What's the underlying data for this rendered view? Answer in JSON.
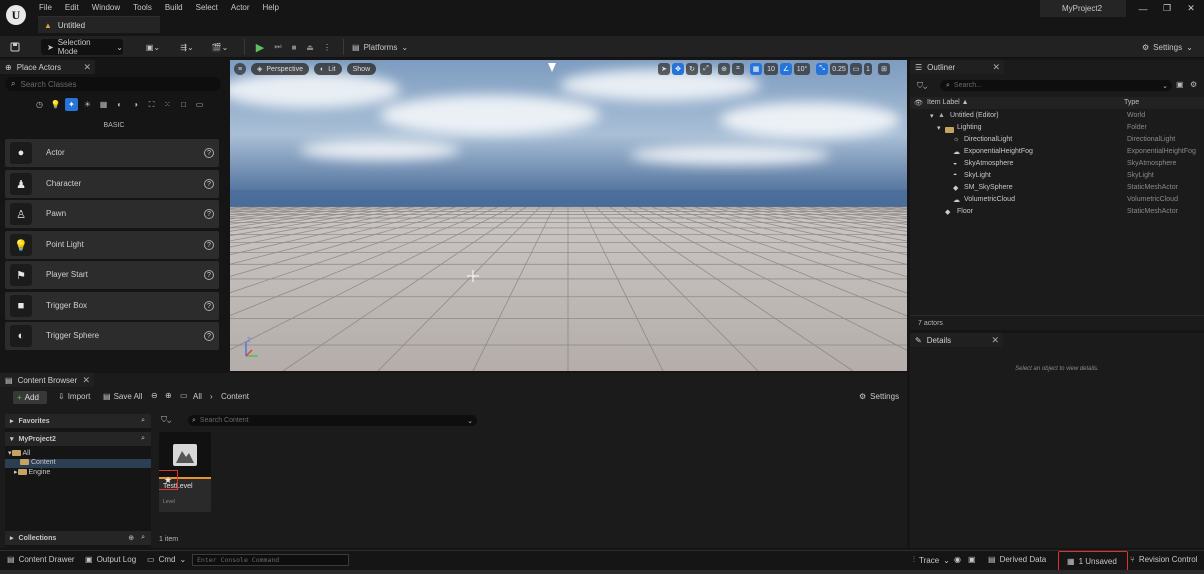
{
  "app": {
    "logo": "U",
    "menu": [
      "File",
      "Edit",
      "Window",
      "Tools",
      "Build",
      "Select",
      "Actor",
      "Help"
    ],
    "document_tab": "Untitled",
    "project": "MyProject2",
    "window_controls": {
      "minimize": "—",
      "maximize": "❐",
      "close": "✕"
    }
  },
  "toolbar": {
    "selection_mode": "Selection Mode",
    "platforms": "Platforms",
    "settings": "Settings"
  },
  "place_actors": {
    "tab": "Place Actors",
    "search_placeholder": "Search Classes",
    "category_label": "BASIC",
    "items": [
      {
        "label": "Actor",
        "icon": "●"
      },
      {
        "label": "Character",
        "icon": "♟"
      },
      {
        "label": "Pawn",
        "icon": "♙"
      },
      {
        "label": "Point Light",
        "icon": "💡"
      },
      {
        "label": "Player Start",
        "icon": "⚑"
      },
      {
        "label": "Trigger Box",
        "icon": "■"
      },
      {
        "label": "Trigger Sphere",
        "icon": "◐"
      }
    ]
  },
  "viewport": {
    "perspective": "Perspective",
    "lit": "Lit",
    "show": "Show",
    "grid_snap": "10",
    "rotation_snap": "10°",
    "scale_snap": "0.25",
    "camera_speed": "1"
  },
  "outliner": {
    "tab": "Outliner",
    "search_placeholder": "Search...",
    "col_label": "Item Label ▲",
    "col_type": "Type",
    "rows": [
      {
        "label": "Untitled (Editor)",
        "type": "World"
      },
      {
        "label": "Lighting",
        "type": "Folder"
      },
      {
        "label": "DirectionalLight",
        "type": "DirectionalLight"
      },
      {
        "label": "ExponentialHeightFog",
        "type": "ExponentialHeightFog"
      },
      {
        "label": "SkyAtmosphere",
        "type": "SkyAtmosphere"
      },
      {
        "label": "SkyLight",
        "type": "SkyLight"
      },
      {
        "label": "SM_SkySphere",
        "type": "StaticMeshActor"
      },
      {
        "label": "VolumetricCloud",
        "type": "VolumetricCloud"
      },
      {
        "label": "Floor",
        "type": "StaticMeshActor"
      }
    ],
    "actor_count": "7 actors"
  },
  "details": {
    "tab": "Details",
    "empty_text": "Select an object to view details."
  },
  "content_browser": {
    "tab": "Content Browser",
    "add": "Add",
    "import": "Import",
    "save_all": "Save All",
    "breadcrumb": [
      "All",
      "Content"
    ],
    "settings": "Settings",
    "favorites": "Favorites",
    "project": "MyProject2",
    "tree": [
      {
        "label": "All"
      },
      {
        "label": "Content"
      },
      {
        "label": "Engine"
      }
    ],
    "collections": "Collections",
    "search_placeholder": "Search Content",
    "asset": {
      "name": "TestLevel",
      "type": "Level"
    },
    "item_count": "1 item"
  },
  "statusbar": {
    "content_drawer": "Content Drawer",
    "output_log": "Output Log",
    "cmd": "Cmd",
    "console_placeholder": "Enter Console Command",
    "trace": "Trace",
    "derived_data": "Derived Data",
    "unsaved": "1 Unsaved",
    "revision_control": "Revision Control"
  },
  "colors": {
    "accent_blue": "#2673d9",
    "play_green": "#5ec05e",
    "level_orange": "#e6952e",
    "highlight_red": "#e03030"
  }
}
